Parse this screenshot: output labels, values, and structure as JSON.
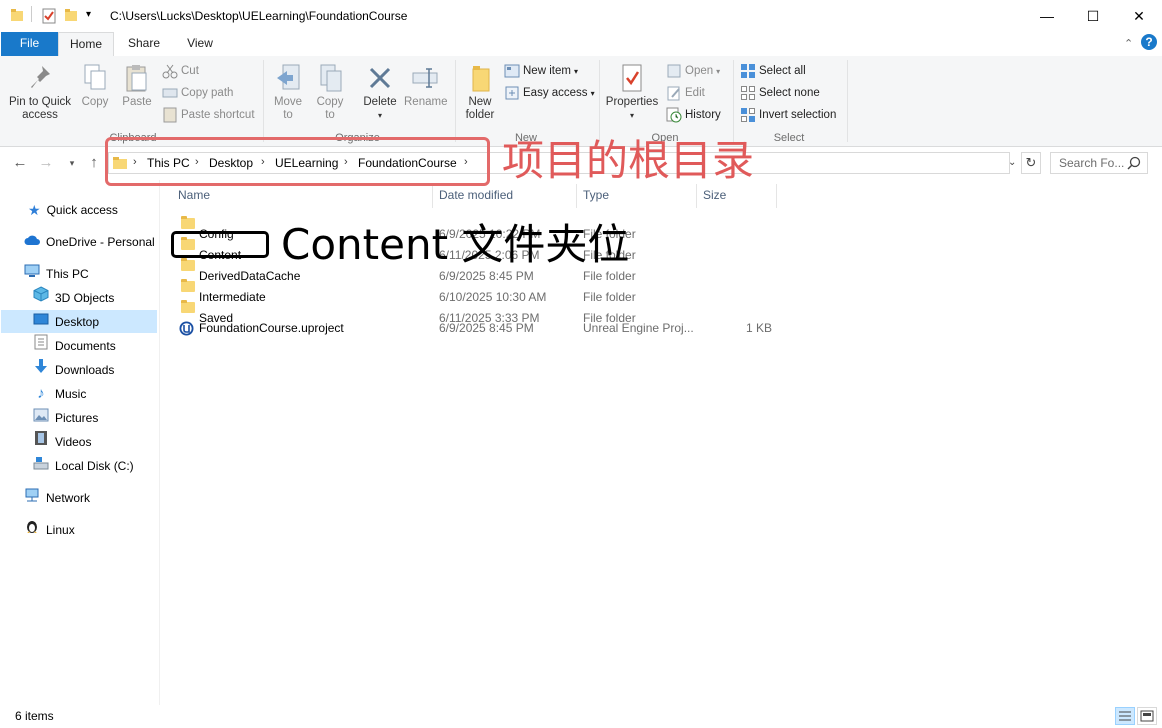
{
  "window": {
    "title_path": "C:\\Users\\Lucks\\Desktop\\UELearning\\FoundationCourse",
    "minimize_glyph": "—",
    "maximize_glyph": "☐",
    "close_glyph": "✕"
  },
  "ribbon_tabs": [
    "File",
    "Home",
    "Share",
    "View"
  ],
  "ribbon": {
    "clipboard": {
      "label": "Clipboard",
      "pin_label_1": "Pin to Quick",
      "pin_label_2": "access",
      "copy": "Copy",
      "paste": "Paste",
      "cut": "Cut",
      "copy_path": "Copy path",
      "paste_shortcut": "Paste shortcut"
    },
    "organize": {
      "label": "Organize",
      "move_to_1": "Move",
      "move_to_2": "to",
      "copy_to_1": "Copy",
      "copy_to_2": "to",
      "delete": "Delete",
      "rename": "Rename"
    },
    "new": {
      "label": "New",
      "new_folder_1": "New",
      "new_folder_2": "folder",
      "new_item": "New item",
      "easy_access": "Easy access"
    },
    "open": {
      "label": "Open",
      "properties": "Properties",
      "open": "Open",
      "edit": "Edit",
      "history": "History"
    },
    "select": {
      "label": "Select",
      "select_all": "Select all",
      "select_none": "Select none",
      "invert_selection": "Invert selection"
    }
  },
  "address": {
    "breadcrumbs": [
      "This PC",
      "Desktop",
      "UELearning",
      "FoundationCourse"
    ],
    "search_placeholder": "Search Fo..."
  },
  "nav_pane": {
    "quick_access": "Quick access",
    "onedrive": "OneDrive - Personal",
    "this_pc": "This PC",
    "objects_3d": "3D Objects",
    "desktop": "Desktop",
    "documents": "Documents",
    "downloads": "Downloads",
    "music": "Music",
    "pictures": "Pictures",
    "videos": "Videos",
    "local_disk": "Local Disk (C:)",
    "network": "Network",
    "linux": "Linux"
  },
  "columns": {
    "name": "Name",
    "date": "Date modified",
    "type": "Type",
    "size": "Size"
  },
  "files": [
    {
      "name": "Config",
      "date": "6/9/2025 10:22 PM",
      "type": "File folder",
      "size": ""
    },
    {
      "name": "Content",
      "date": "6/11/2025 2:06 PM",
      "type": "File folder",
      "size": ""
    },
    {
      "name": "DerivedDataCache",
      "date": "6/9/2025 8:45 PM",
      "type": "File folder",
      "size": ""
    },
    {
      "name": "Intermediate",
      "date": "6/10/2025 10:30 AM",
      "type": "File folder",
      "size": ""
    },
    {
      "name": "Saved",
      "date": "6/11/2025 3:33 PM",
      "type": "File folder",
      "size": ""
    },
    {
      "name": "FoundationCourse.uproject",
      "date": "6/9/2025 8:45 PM",
      "type": "Unreal Engine Proj...",
      "size": "1 KB"
    }
  ],
  "annotations": {
    "root_label": "项目的根目录",
    "content_label": "Content 文件夹位"
  },
  "status": {
    "item_count": "6 items"
  },
  "colors": {
    "accent": "#1979ca",
    "selection": "#cce8ff",
    "annotation_red": "#e05a5a",
    "folder": "#f8d775"
  }
}
